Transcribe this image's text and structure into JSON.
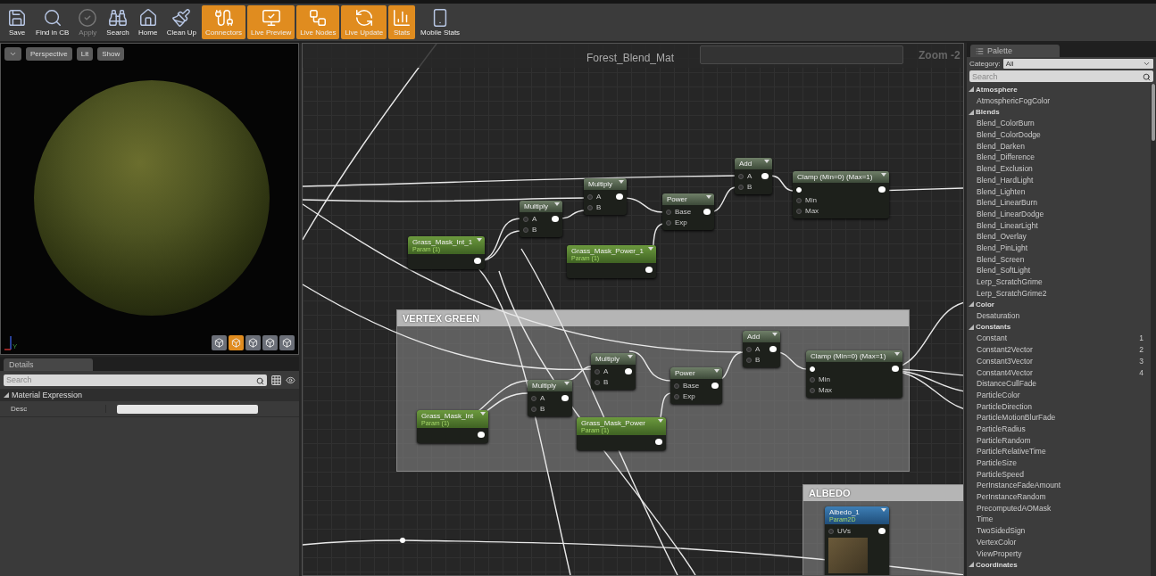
{
  "toolbar": [
    {
      "label": "Save",
      "active": false,
      "disabled": false
    },
    {
      "label": "Find in CB",
      "active": false,
      "disabled": false
    },
    {
      "label": "Apply",
      "active": false,
      "disabled": true
    },
    {
      "label": "Search",
      "active": false,
      "disabled": false
    },
    {
      "label": "Home",
      "active": false,
      "disabled": false
    },
    {
      "label": "Clean Up",
      "active": false,
      "disabled": false
    },
    {
      "label": "Connectors",
      "active": true,
      "disabled": false
    },
    {
      "label": "Live Preview",
      "active": true,
      "disabled": false
    },
    {
      "label": "Live Nodes",
      "active": true,
      "disabled": false
    },
    {
      "label": "Live Update",
      "active": true,
      "disabled": false
    },
    {
      "label": "Stats",
      "active": true,
      "disabled": false
    },
    {
      "label": "Mobile Stats",
      "active": false,
      "disabled": false
    }
  ],
  "viewport": {
    "buttons": [
      "Perspective",
      "Lit",
      "Show"
    ],
    "axis_label": "Y",
    "view_buttons": [
      {
        "selected": false
      },
      {
        "selected": true
      },
      {
        "selected": false
      },
      {
        "selected": false
      },
      {
        "selected": false
      }
    ]
  },
  "details": {
    "tab": "Details",
    "search": {
      "placeholder": "Search"
    },
    "section": {
      "title": "Material Expression",
      "expanded": true
    },
    "rows": [
      {
        "label": "Desc"
      }
    ]
  },
  "graph": {
    "title": "Forest_Blend_Mat",
    "zoom": "Zoom -2",
    "nodes": [
      {
        "kind": "param",
        "title": "Grass_Mask_Int_1",
        "subtitle": "Param (1)"
      },
      {
        "kind": "math",
        "title": "Multiply",
        "inputs": [
          "A",
          "B"
        ]
      },
      {
        "kind": "math",
        "title": "Multiply",
        "inputs": [
          "A",
          "B"
        ]
      },
      {
        "kind": "param",
        "title": "Grass_Mask_Power_1",
        "subtitle": "Param (1)"
      },
      {
        "kind": "math",
        "title": "Power",
        "inputs": [
          "Base",
          "Exp"
        ]
      },
      {
        "kind": "math",
        "title": "Add",
        "inputs": [
          "A",
          "B"
        ]
      },
      {
        "kind": "math",
        "title": "Clamp (Min=0) (Max=1)",
        "main_input": true,
        "inputs": [
          "Min",
          "Max"
        ]
      }
    ],
    "comments": [
      {
        "title": "VERTEX GREEN",
        "nodes": [
          {
            "kind": "param",
            "title": "Grass_Mask_Int",
            "subtitle": "Param (1)"
          },
          {
            "kind": "math",
            "title": "Multiply",
            "inputs": [
              "A",
              "B"
            ]
          },
          {
            "kind": "math",
            "title": "Multiply",
            "inputs": [
              "A",
              "B"
            ]
          },
          {
            "kind": "param",
            "title": "Grass_Mask_Power",
            "subtitle": "Param (1)"
          },
          {
            "kind": "math",
            "title": "Power",
            "inputs": [
              "Base",
              "Exp"
            ]
          },
          {
            "kind": "math",
            "title": "Add",
            "inputs": [
              "A",
              "B"
            ]
          },
          {
            "kind": "math",
            "title": "Clamp (Min=0) (Max=1)",
            "main_input": true,
            "inputs": [
              "Min",
              "Max"
            ]
          }
        ]
      },
      {
        "title": "ALBEDO",
        "nodes": [
          {
            "kind": "texture",
            "title": "Albedo_1",
            "subtitle": "Param2D",
            "inputs": [
              "UVs"
            ]
          }
        ]
      }
    ]
  },
  "palette": {
    "tab": "Palette",
    "category_label": "Category:",
    "category": "All",
    "search": {
      "placeholder": "Search"
    },
    "categories": [
      {
        "label": "Atmosphere",
        "expanded": true,
        "children": [
          {
            "label": "AtmosphericFogColor"
          }
        ]
      },
      {
        "label": "Blends",
        "expanded": true,
        "children": [
          {
            "label": "Blend_ColorBurn"
          },
          {
            "label": "Blend_ColorDodge"
          },
          {
            "label": "Blend_Darken"
          },
          {
            "label": "Blend_Difference"
          },
          {
            "label": "Blend_Exclusion"
          },
          {
            "label": "Blend_HardLight"
          },
          {
            "label": "Blend_Lighten"
          },
          {
            "label": "Blend_LinearBurn"
          },
          {
            "label": "Blend_LinearDodge"
          },
          {
            "label": "Blend_LinearLight"
          },
          {
            "label": "Blend_Overlay"
          },
          {
            "label": "Blend_PinLight"
          },
          {
            "label": "Blend_Screen"
          },
          {
            "label": "Blend_SoftLight"
          },
          {
            "label": "Lerp_ScratchGrime"
          },
          {
            "label": "Lerp_ScratchGrime2"
          }
        ]
      },
      {
        "label": "Color",
        "expanded": true,
        "children": [
          {
            "label": "Desaturation"
          }
        ]
      },
      {
        "label": "Constants",
        "expanded": true,
        "children": [
          {
            "label": "Constant",
            "shortcut": "1"
          },
          {
            "label": "Constant2Vector",
            "shortcut": "2"
          },
          {
            "label": "Constant3Vector",
            "shortcut": "3"
          },
          {
            "label": "Constant4Vector",
            "shortcut": "4"
          },
          {
            "label": "DistanceCullFade"
          },
          {
            "label": "ParticleColor"
          },
          {
            "label": "ParticleDirection"
          },
          {
            "label": "ParticleMotionBlurFade"
          },
          {
            "label": "ParticleRadius"
          },
          {
            "label": "ParticleRandom"
          },
          {
            "label": "ParticleRelativeTime"
          },
          {
            "label": "ParticleSize"
          },
          {
            "label": "ParticleSpeed"
          },
          {
            "label": "PerInstanceFadeAmount"
          },
          {
            "label": "PerInstanceRandom"
          },
          {
            "label": "PrecomputedAOMask"
          },
          {
            "label": "Time"
          },
          {
            "label": "TwoSidedSign"
          },
          {
            "label": "VertexColor"
          },
          {
            "label": "ViewProperty"
          }
        ]
      },
      {
        "label": "Coordinates",
        "expanded": true
      }
    ]
  }
}
